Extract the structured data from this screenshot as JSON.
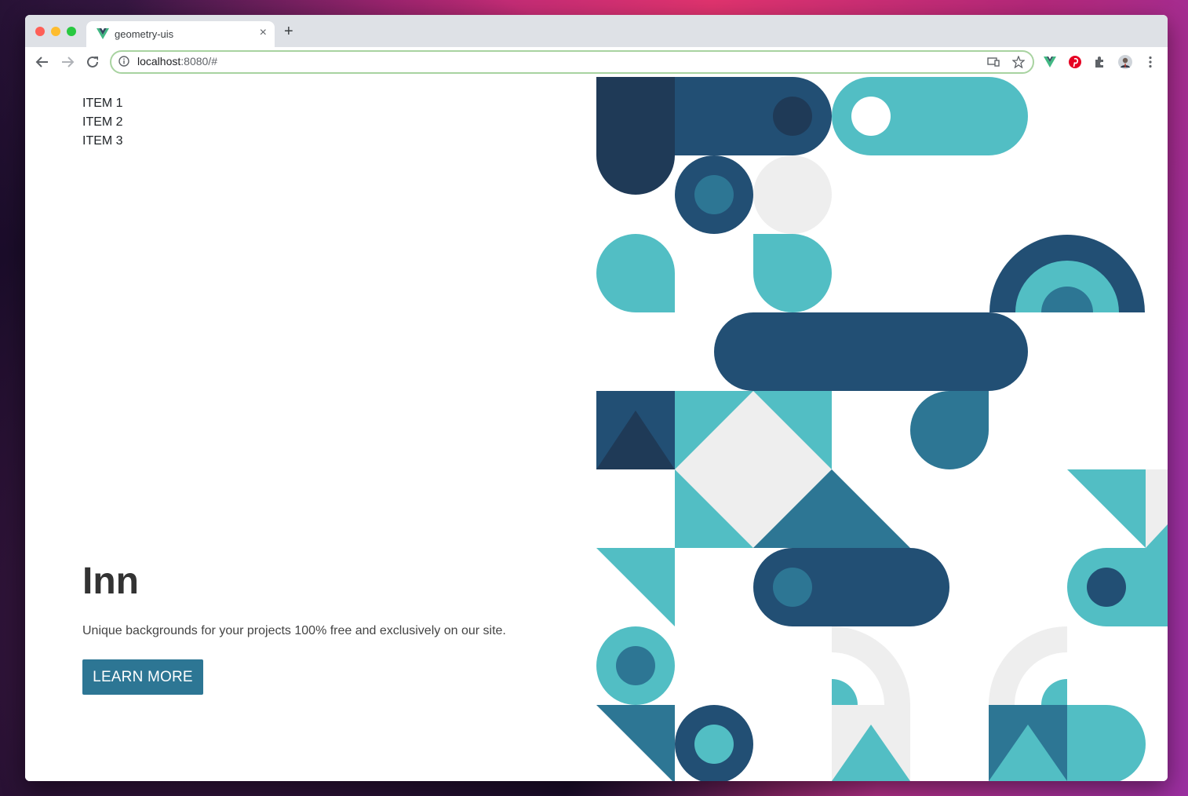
{
  "browser": {
    "tab_title": "geometry-uis",
    "tab_close": "×",
    "new_tab": "+",
    "url_host": "localhost",
    "url_path": ":8080/#"
  },
  "nav": {
    "items": [
      "ITEM 1",
      "ITEM 2",
      "ITEM 3"
    ]
  },
  "hero": {
    "title": "Inn",
    "description": "Unique backgrounds for your projects 100% free and exclusively on our site.",
    "cta_label": "LEARN MORE"
  },
  "colors": {
    "navy": "#1f3a57",
    "blue": "#224f74",
    "teal": "#2d7694",
    "aqua": "#52bec4",
    "light": "#eeeeee",
    "button": "#2d7694"
  },
  "icons": [
    "vue-favicon",
    "back-icon",
    "forward-icon",
    "reload-icon",
    "info-icon",
    "cast-icon",
    "star-icon",
    "vue-devtools-icon",
    "pinterest-icon",
    "extensions-icon",
    "profile-avatar",
    "menu-icon"
  ]
}
